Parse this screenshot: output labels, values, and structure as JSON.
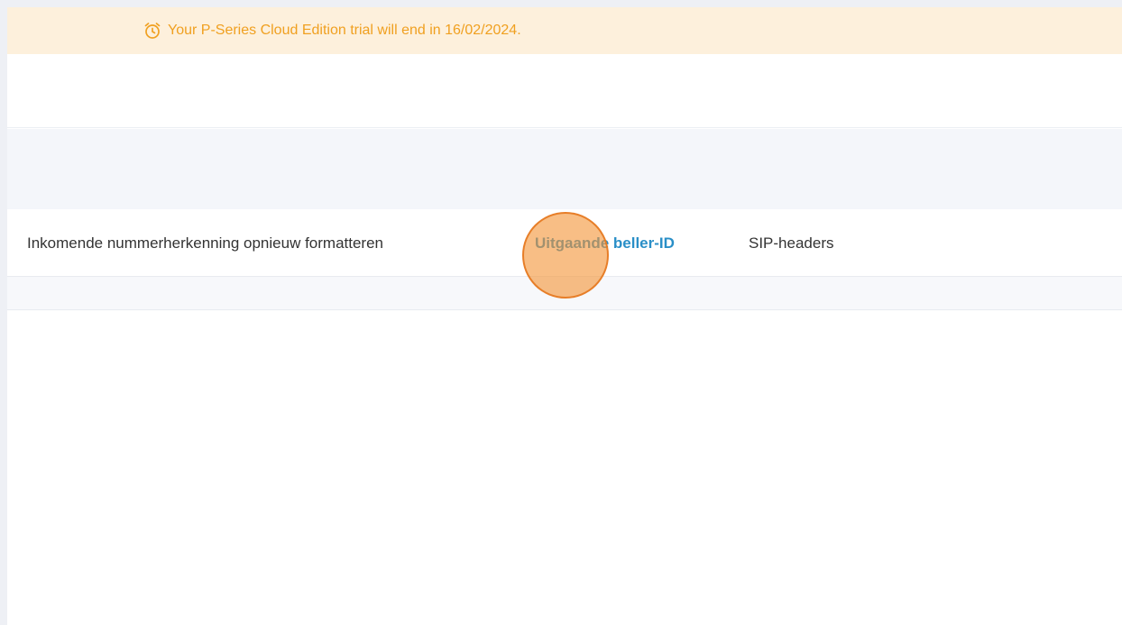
{
  "banner": {
    "icon": "alarm-clock-icon",
    "text": "Your P-Series Cloud Edition trial will end in 16/02/2024.",
    "color": "#f0a020",
    "background": "#fdf0dc"
  },
  "tabs": [
    {
      "label": "Inkomende nummerherkenning opnieuw formatteren",
      "active": false
    },
    {
      "label": "Uitgaande beller-ID",
      "active": true
    },
    {
      "label": "SIP-headers",
      "active": false
    }
  ],
  "colors": {
    "active_tab": "#2a8fc7",
    "click_indicator": "#f49234"
  }
}
